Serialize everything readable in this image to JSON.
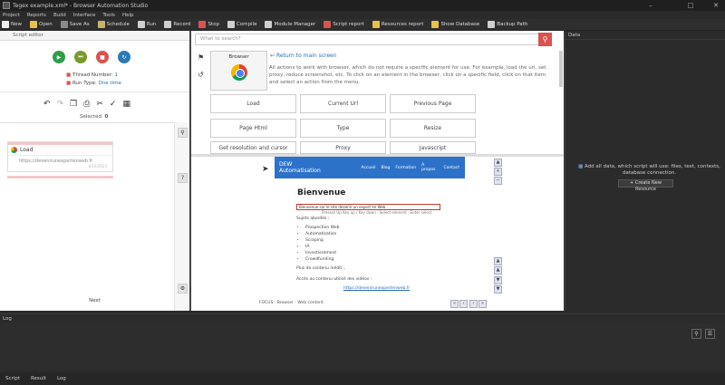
{
  "window": {
    "title": "Tegex example.xml* - Browser Automation Studio"
  },
  "menu": [
    "Project",
    "Reports",
    "Build",
    "Interface",
    "Tools",
    "Help"
  ],
  "toolbar": [
    {
      "label": "New",
      "icon": "new-file-icon",
      "color": "#f0f0f0"
    },
    {
      "label": "Open",
      "icon": "folder-open-icon",
      "color": "#e8c14a"
    },
    {
      "label": "Save As",
      "icon": "save-icon",
      "color": "#8a8a8a"
    },
    {
      "label": "Schedule",
      "icon": "calendar-icon",
      "color": "#c8b36a"
    },
    {
      "label": "Run",
      "icon": "play-icon",
      "color": "#cfcfcf"
    },
    {
      "label": "Record",
      "icon": "record-icon",
      "color": "#cfcfcf"
    },
    {
      "label": "Stop",
      "icon": "stop-icon",
      "color": "#d9534f"
    },
    {
      "label": "Compile",
      "icon": "compile-icon",
      "color": "#cfcfcf"
    },
    {
      "label": "Module Manager",
      "icon": "module-icon",
      "color": "#cfcfcf"
    },
    {
      "label": "Script report",
      "icon": "script-report-icon",
      "color": "#d9534f"
    },
    {
      "label": "Resources report",
      "icon": "resources-report-icon",
      "color": "#e8c14a"
    },
    {
      "label": "Show Database",
      "icon": "database-icon",
      "color": "#e8c14a"
    },
    {
      "label": "Backup Path",
      "icon": "backup-icon",
      "color": "#cfcfcf"
    }
  ],
  "left": {
    "header": "Script editor",
    "thread_label": "Thread Number:",
    "thread_value": "1",
    "runtype_label": "Run Type:",
    "runtype_value": "One time",
    "selected_label": "Selected:",
    "selected_value": "0",
    "card_title": "Load",
    "card_url": "https://devenirunexpertenweb.fr",
    "card_date": "4/10/2023",
    "next_label": "Next"
  },
  "mid": {
    "search_placeholder": "What to search?",
    "browser_tile": "Browser",
    "back_link": "Return to main screen",
    "description": "All actions to work with browser, which do not require a specific element for use. For example, load the url, set proxy, reduce screenshot, etc. To click on an element in the browser, click on a specific field, click on that item and select an action from the menu.",
    "buttons": [
      "Load",
      "Current Url",
      "Previous Page",
      "Page Html",
      "Type",
      "Resize",
      "Get resolution and cursor position",
      "Proxy",
      "Javascript"
    ]
  },
  "webpage": {
    "brand": "DEW Automatisation",
    "links": [
      "Accueil",
      "Blog",
      "Formation",
      "A propos",
      "Contact"
    ],
    "heading": "Bienvenue",
    "highlight": "Bienvenue sur le site devenir un expert en Web",
    "hint": "Pressez Up Key up / Key down · Select element · Enter select",
    "intro": "Sujets abordés :",
    "items": [
      "Prospection Web",
      "Automatisation",
      "Scraping",
      "IA",
      "Investissement",
      "Crowdfunding"
    ],
    "more": "Plus de contenu inédit...",
    "site_text": "Accès au contenu utilisé des vidéos :",
    "site_link": "https://devenirunexpertenweb.fr",
    "status": "FOCUS · Browser · Web content"
  },
  "right": {
    "header": "Data",
    "message": "Add all data, which script will use: files, text, contexts, database connection.",
    "button": "+ Create New Resource"
  },
  "log": {
    "header": "Log"
  },
  "tabs": [
    "Script",
    "Result",
    "Log"
  ]
}
